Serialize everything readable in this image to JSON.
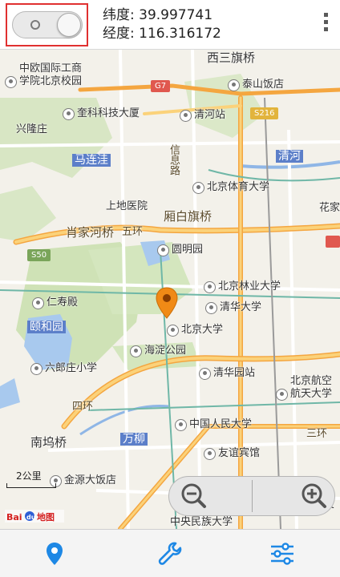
{
  "header": {
    "latitude_label": "纬度: 39.997741",
    "longitude_label": "经度: 116.316172"
  },
  "map": {
    "labels": {
      "xisanqi_bridge": "西三旗桥",
      "zhongou_school": "中欧国际工商",
      "zhongou_school_2": "学院北京校园",
      "taishan_hotel": "泰山饭店",
      "xinglong": "兴隆庄",
      "kejiandasha": "奎科科技大厦",
      "qinghe_station": "清河站",
      "malianwa": "马连洼",
      "qinghe_area": "清河",
      "xinxilu": "信息路",
      "bsu": "北京体育大学",
      "shangdi_hospital": "上地医院",
      "xiaoyuan_bridge": "厢白旗桥",
      "xiaojia_bridge": "肖家河桥",
      "wuhuan": "五环",
      "huajia": "花家",
      "yuanmingyuan": "圆明园",
      "bjfu": "北京林业大学",
      "renshoudian": "仁寿殿",
      "tsinghua": "清华大学",
      "yiheyuan": "颐和园",
      "pku": "北京大学",
      "haidian_park": "海淀公园",
      "liulangzhuang": "六郎庄小学",
      "tsinghua_station": "清华园站",
      "buaa": "北京航空",
      "buaa_2": "航天大学",
      "sihuan": "四环",
      "nanwu_bridge": "南坞桥",
      "renda": "中国人民大学",
      "wanliu": "万柳",
      "sanhuan": "三环",
      "friendship_hotel": "友谊宾馆",
      "quanyuan_hotel": "金源大饭店",
      "minzu": "中央民族大学",
      "jiaotong": "交"
    },
    "road_shields": {
      "g7": "G7",
      "s216": "S216",
      "s50": "S50"
    },
    "scale_text": "2公里",
    "logo_text": "Bai du 地图"
  },
  "icons": {
    "location": "location-pin-icon",
    "tools": "wrench-icon",
    "settings": "sliders-icon"
  },
  "colors": {
    "accent_blue": "#1e88e5",
    "pin_orange": "#f08a16",
    "highlight_red": "#e03030"
  }
}
